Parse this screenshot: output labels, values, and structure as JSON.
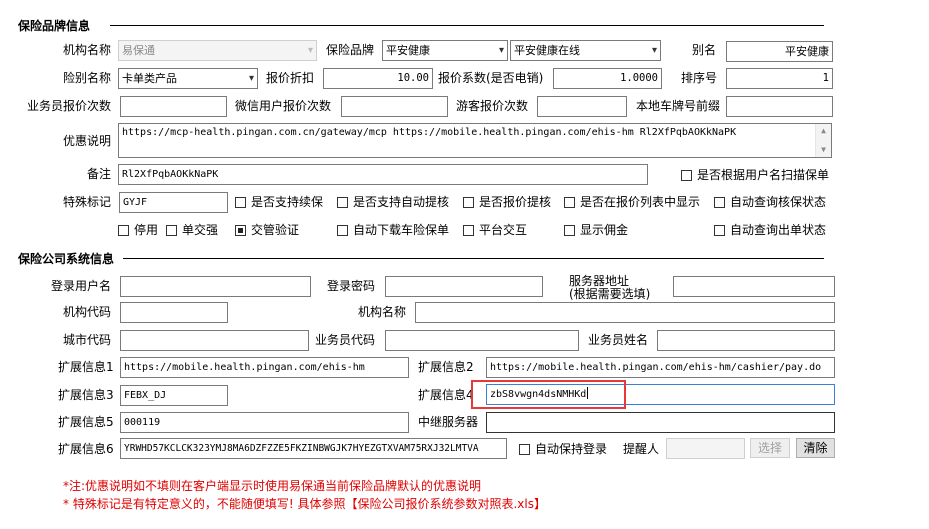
{
  "section1": {
    "title": "保险品牌信息",
    "org_name_label": "机构名称",
    "org_name_value": "易保通",
    "brand_label": "保险品牌",
    "brand_value": "平安健康",
    "brand_sub_value": "平安健康在线",
    "alias_label": "别名",
    "alias_value": "平安健康",
    "insurance_type_label": "险别名称",
    "insurance_type_value": "卡单类产品",
    "discount_label": "报价折扣",
    "discount_value": "10.00",
    "coef_label": "报价系数(是否电销)",
    "coef_value": "1.0000",
    "order_label": "排序号",
    "order_value": "1",
    "agent_count_label": "业务员报价次数",
    "agent_count_value": "",
    "wechat_count_label": "微信用户报价次数",
    "wechat_count_value": "",
    "guest_count_label": "游客报价次数",
    "guest_count_value": "",
    "plate_prefix_label": "本地车牌号前缀",
    "plate_prefix_value": "",
    "promo_label": "优惠说明",
    "promo_value": "https://mcp-health.pingan.com.cn/gateway/mcp  https://mobile.health.pingan.com/ehis-hm  Rl2XfPqbAOKkNaPK",
    "remark_label": "备注",
    "remark_value": "Rl2XfPqbAOKkNaPK",
    "scan_check_label": "是否根据用户名扫描保单",
    "special_label": "特殊标记",
    "special_value": "GYJF",
    "cb_renew": "是否支持续保",
    "cb_auto_withdraw": "是否支持自动提核",
    "cb_quote_withdraw": "是否报价提核",
    "cb_show_list": "是否在报价列表中显示",
    "cb_auto_query_policy": "自动查询核保状态",
    "cb_disabled": "停用",
    "cb_single": "单交强",
    "cb_traffic_verify": "交管验证",
    "cb_auto_download": "自动下载车险保单",
    "cb_platform": "平台交互",
    "cb_show_commission": "显示佣金",
    "cb_auto_query_issue": "自动查询出单状态"
  },
  "section2": {
    "title": "保险公司系统信息",
    "login_user_label": "登录用户名",
    "login_user_value": "",
    "login_pwd_label": "登录密码",
    "login_pwd_value": "",
    "server_addr_label_1": "服务器地址",
    "server_addr_label_2": "(根据需要选填)",
    "server_addr_value": "",
    "org_code_label": "机构代码",
    "org_code_value": "",
    "org_name_label": "机构名称",
    "org_name_value": "",
    "city_code_label": "城市代码",
    "city_code_value": "",
    "agent_code_label": "业务员代码",
    "agent_code_value": "",
    "agent_name_label": "业务员姓名",
    "agent_name_value": "",
    "ext1_label": "扩展信息1",
    "ext1_value": "https://mobile.health.pingan.com/ehis-hm",
    "ext2_label": "扩展信息2",
    "ext2_value": "https://mobile.health.pingan.com/ehis-hm/cashier/pay.do",
    "ext3_label": "扩展信息3",
    "ext3_value": "FEBX_DJ",
    "ext4_label": "扩展信息4",
    "ext4_value": "zbS8vwgn4dsNMHKd",
    "ext5_label": "扩展信息5",
    "ext5_value": "000119",
    "relay_label": "中继服务器",
    "relay_value": "",
    "ext6_label": "扩展信息6",
    "ext6_value": "YRWHD57KCLCK323YMJ8MA6DZFZZE5FKZINBWGJK7HYEZGTXVAM75RXJ32LMTVA",
    "auto_login_label": "自动保持登录",
    "reminder_label": "提醒人",
    "reminder_value": "",
    "select_button": "选择",
    "clear_button": "清除"
  },
  "notes": {
    "note1": "*注:优惠说明如不填则在客户端显示时使用易保通当前保险品牌默认的优惠说明",
    "note2": "* 特殊标记是有特定意义的，不能随便填写! 具体参照【保险公司报价系统参数对照表.xls】"
  },
  "colors": {
    "highlight": "#e8393a",
    "note": "#e00000"
  }
}
